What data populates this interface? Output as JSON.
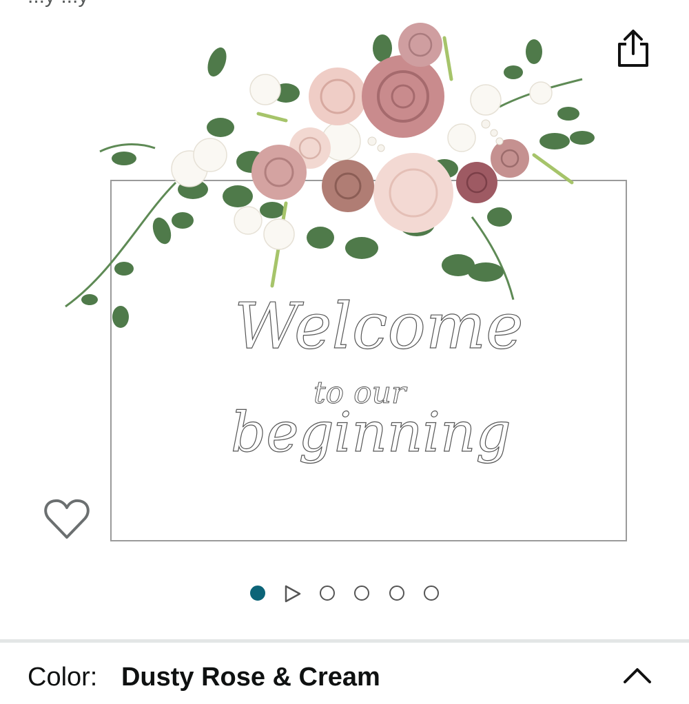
{
  "top_partial_text": "...y ...y",
  "icons": {
    "share": "share-icon",
    "wishlist": "heart-outline-icon",
    "video": "play-triangle-icon",
    "collapse": "chevron-up-icon"
  },
  "product_image": {
    "sign_line_1": "Welcome",
    "sign_line_2": "to our",
    "sign_line_3": "beginning"
  },
  "carousel": {
    "active_index": 0,
    "dot_count": 6,
    "video_index": 1
  },
  "variation": {
    "label": "Color:",
    "value": "Dusty Rose & Cream"
  },
  "colors": {
    "accent": "#0c6478",
    "divider": "#e3e6e6",
    "dusty_rose": "#c98b8d",
    "blush": "#f0d2cc",
    "mauve": "#b7777a",
    "leaf": "#4f7a4a"
  }
}
